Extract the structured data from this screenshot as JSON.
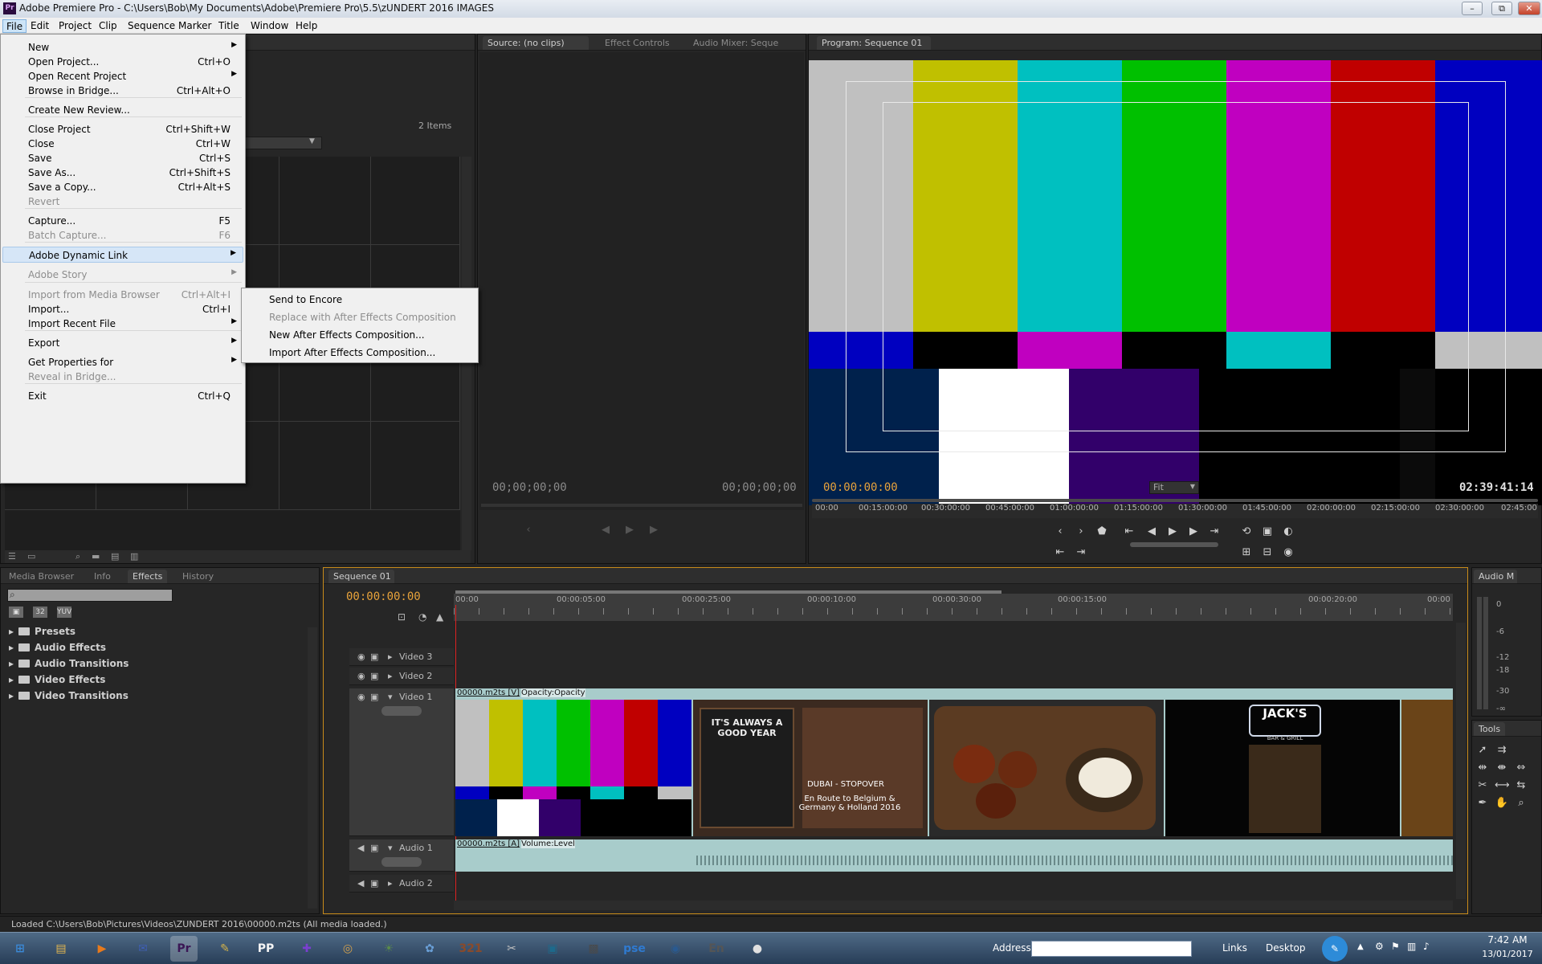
{
  "window": {
    "title": "Adobe Premiere Pro - C:\\Users\\Bob\\My Documents\\Adobe\\Premiere Pro\\5.5\\zUNDERT 2016  IMAGES",
    "app_icon": "Pr",
    "minimize": "–",
    "maximize": "⧉",
    "close": "✕"
  },
  "menubar": [
    "File",
    "Edit",
    "Project",
    "Clip",
    "Sequence",
    "Marker",
    "Title",
    "Window",
    "Help"
  ],
  "file_menu": {
    "items": [
      {
        "label": "New",
        "shortcut": "",
        "submenu": true,
        "disabled": false
      },
      {
        "label": "Open Project...",
        "shortcut": "Ctrl+O",
        "submenu": false,
        "disabled": false
      },
      {
        "label": "Open Recent Project",
        "shortcut": "",
        "submenu": true,
        "disabled": false
      },
      {
        "label": "Browse in Bridge...",
        "shortcut": "Ctrl+Alt+O",
        "submenu": false,
        "disabled": false
      },
      {
        "label": "Create New Review...",
        "shortcut": "",
        "submenu": false,
        "disabled": false
      },
      {
        "label": "Close Project",
        "shortcut": "Ctrl+Shift+W",
        "submenu": false,
        "disabled": false
      },
      {
        "label": "Close",
        "shortcut": "Ctrl+W",
        "submenu": false,
        "disabled": false
      },
      {
        "label": "Save",
        "shortcut": "Ctrl+S",
        "submenu": false,
        "disabled": false
      },
      {
        "label": "Save As...",
        "shortcut": "Ctrl+Shift+S",
        "submenu": false,
        "disabled": false
      },
      {
        "label": "Save a Copy...",
        "shortcut": "Ctrl+Alt+S",
        "submenu": false,
        "disabled": false
      },
      {
        "label": "Revert",
        "shortcut": "",
        "submenu": false,
        "disabled": true
      },
      {
        "label": "Capture...",
        "shortcut": "F5",
        "submenu": false,
        "disabled": false
      },
      {
        "label": "Batch Capture...",
        "shortcut": "F6",
        "submenu": false,
        "disabled": true
      },
      {
        "label": "Adobe Dynamic Link",
        "shortcut": "",
        "submenu": true,
        "disabled": false
      },
      {
        "label": "Adobe Story",
        "shortcut": "",
        "submenu": true,
        "disabled": true
      },
      {
        "label": "Import from Media Browser",
        "shortcut": "Ctrl+Alt+I",
        "submenu": false,
        "disabled": true
      },
      {
        "label": "Import...",
        "shortcut": "Ctrl+I",
        "submenu": false,
        "disabled": false
      },
      {
        "label": "Import Recent File",
        "shortcut": "",
        "submenu": true,
        "disabled": false
      },
      {
        "label": "Export",
        "shortcut": "",
        "submenu": true,
        "disabled": false
      },
      {
        "label": "Get Properties for",
        "shortcut": "",
        "submenu": true,
        "disabled": false
      },
      {
        "label": "Reveal in Bridge...",
        "shortcut": "",
        "submenu": false,
        "disabled": true
      },
      {
        "label": "Exit",
        "shortcut": "Ctrl+Q",
        "submenu": false,
        "disabled": false
      }
    ]
  },
  "dynamic_link_submenu": {
    "items": [
      {
        "label": "Send to Encore",
        "disabled": false
      },
      {
        "label": "Replace with After Effects Composition",
        "disabled": true
      },
      {
        "label": "New After Effects Composition...",
        "disabled": false
      },
      {
        "label": "Import After Effects Composition...",
        "disabled": false
      }
    ]
  },
  "project_panel": {
    "item_count": "2 Items"
  },
  "source_monitor": {
    "tabs": [
      "Source: (no clips)",
      "Effect Controls",
      "Audio Mixer: Seque"
    ],
    "timecode_in": "00;00;00;00",
    "timecode_out": "00;00;00;00"
  },
  "program_monitor": {
    "tab": "Program: Sequence 01",
    "timecode": "00:00:00:00",
    "duration": "02:39:41:14",
    "fit": "Fit",
    "ruler": [
      "00:00",
      "00:15:00:00",
      "00:30:00:00",
      "00:45:00:00",
      "01:00:00:00",
      "01:15:00:00",
      "01:30:00:00",
      "01:45:00:00",
      "02:00:00:00",
      "02:15:00:00",
      "02:30:00:00",
      "02:45:00"
    ]
  },
  "effects_panel": {
    "tabs": [
      "Media Browser",
      "Info",
      "Effects",
      "History"
    ],
    "tree": [
      "Presets",
      "Audio Effects",
      "Audio Transitions",
      "Video Effects",
      "Video Transitions"
    ]
  },
  "timeline": {
    "tab": "Sequence 01",
    "timecode": "00:00:00:00",
    "ruler": [
      "00:00",
      "00:00:05:00",
      "00:00:10:00",
      "00:00:15:00",
      "00:00:20:00",
      "00:00:25:00",
      "00:00:30:00",
      "00:00"
    ],
    "tracks": [
      "Video 3",
      "Video 2",
      "Video 1",
      "Audio 1",
      "Audio 2"
    ],
    "video_clip": "00000.m2ts [V]",
    "video_fx": "Opacity:Opacity",
    "audio_clip": "00000.m2ts [A]",
    "audio_fx": "Volume:Level",
    "thumb_text_1": "IT'S ALWAYS A GOOD YEAR",
    "thumb_text_2": "DUBAI - STOPOVER",
    "thumb_text_3": "En Route to Belgium & Germany & Holland 2016",
    "thumb_text_4": "JACK'S",
    "thumb_text_5": "BAR & GRILL"
  },
  "audio_meter": {
    "label": "Audio M",
    "scale": [
      "0",
      "-6",
      "-12",
      "-18",
      "-30",
      "-∞"
    ]
  },
  "tools_panel": {
    "label": "Tools"
  },
  "status": "Loaded C:\\Users\\Bob\\Pictures\\Videos\\ZUNDERT 2016\\00000.m2ts (All media loaded.)",
  "taskbar": {
    "address_label": "Address",
    "links": "Links",
    "desktop": "Desktop",
    "time": "7:42 AM",
    "date": "13/01/2017",
    "icons": [
      {
        "name": "start-orb-icon",
        "glyph": "⊞",
        "color": "#3b8ad8"
      },
      {
        "name": "folder-icon",
        "glyph": "▤",
        "color": "#e2b650"
      },
      {
        "name": "media-player-icon",
        "glyph": "▶",
        "color": "#e87a1c"
      },
      {
        "name": "mail-icon",
        "glyph": "✉",
        "color": "#3f5fb5"
      },
      {
        "name": "premiere-icon",
        "glyph": "Pr",
        "color": "#3a1655"
      },
      {
        "name": "paint-brush-icon",
        "glyph": "✎",
        "color": "#d6b44a"
      },
      {
        "name": "pp-icon",
        "glyph": "PP",
        "color": "#f4f4f4"
      },
      {
        "name": "calendar-icon",
        "glyph": "✚",
        "color": "#7a3fd0"
      },
      {
        "name": "dvd-icon",
        "glyph": "◎",
        "color": "#d6a24d"
      },
      {
        "name": "photo-icon",
        "glyph": "☀",
        "color": "#5a8a4a"
      },
      {
        "name": "palette-icon",
        "glyph": "✿",
        "color": "#6aa0d8"
      },
      {
        "name": "counter-icon",
        "glyph": "321",
        "color": "#8a4a2a"
      },
      {
        "name": "scissors-icon",
        "glyph": "✂",
        "color": "#c0c0c0"
      },
      {
        "name": "film-icon",
        "glyph": "▣",
        "color": "#1d6a8c"
      },
      {
        "name": "movie-icon",
        "glyph": "▩",
        "color": "#4a4a4a"
      },
      {
        "name": "pse-icon",
        "glyph": "pse",
        "color": "#2f7ad0"
      },
      {
        "name": "camera-icon",
        "glyph": "◉",
        "color": "#2a5a90"
      },
      {
        "name": "encore-icon",
        "glyph": "En",
        "color": "#555555"
      },
      {
        "name": "chrome-icon",
        "glyph": "●",
        "color": "#e0e0e0"
      }
    ]
  }
}
